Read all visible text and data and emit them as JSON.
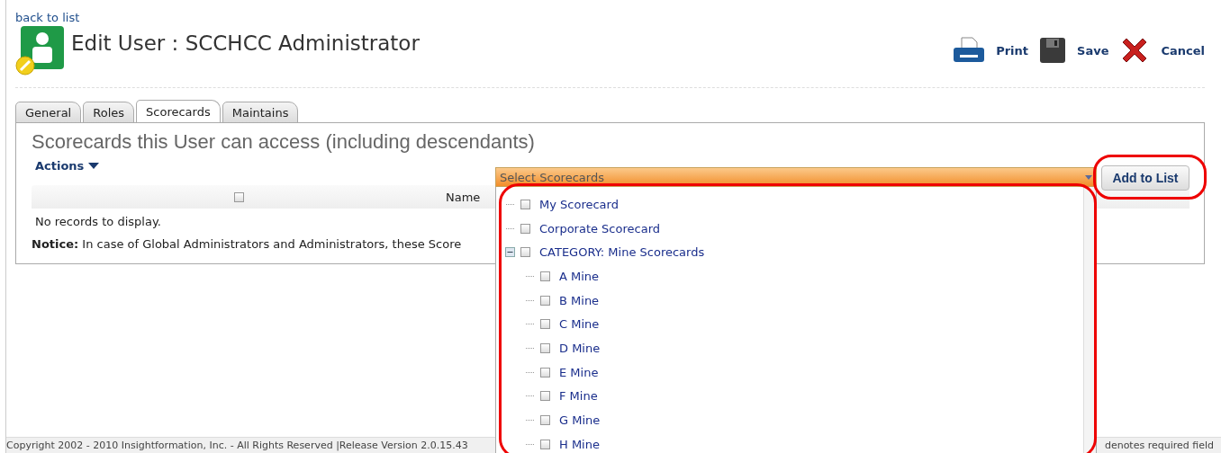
{
  "back_link": "back to list",
  "title": "Edit User : SCCHCC Administrator",
  "toolbar": [
    {
      "kind": "print",
      "label": "Print"
    },
    {
      "kind": "save",
      "label": "Save"
    },
    {
      "kind": "cancel",
      "label": "Cancel"
    }
  ],
  "tabs": [
    {
      "label": "General",
      "selected": false
    },
    {
      "label": "Roles",
      "selected": false
    },
    {
      "label": "Scorecards",
      "selected": true
    },
    {
      "label": "Maintains",
      "selected": false
    }
  ],
  "panel": {
    "heading": "Scorecards this User can access (including descendants)",
    "actions": "Actions",
    "table": {
      "columns": [
        {
          "kind": "checkbox",
          "checked": false
        },
        {
          "kind": "text",
          "label": "Name"
        }
      ],
      "empty": "No records to display."
    },
    "notice": "**Notice:** In case of Global Administrators and Administrators, these Score"
  },
  "picker": {
    "placeholder": "Select Scorecards",
    "button": "Add to List",
    "items": [
      {
        "label": "My Scorecard",
        "checked": false
      },
      {
        "label": "Corporate Scorecard",
        "checked": false
      },
      {
        "label": "CATEGORY: Mine Scorecards",
        "checked": false,
        "expanded": true,
        "children": [
          {
            "label": "A Mine",
            "checked": false
          },
          {
            "label": "B Mine",
            "checked": false
          },
          {
            "label": "C Mine",
            "checked": false
          },
          {
            "label": "D Mine",
            "checked": false
          },
          {
            "label": "E Mine",
            "checked": false
          },
          {
            "label": "F Mine",
            "checked": false
          },
          {
            "label": "G Mine",
            "checked": false
          },
          {
            "label": "H Mine",
            "checked": false
          }
        ]
      }
    ]
  },
  "footer": {
    "copyright": "Copyright 2002 - 2010 Insightformation, Inc. - All Rights Reserved |Release Version 2.0.15.43",
    "required_note": "denotes required field"
  }
}
